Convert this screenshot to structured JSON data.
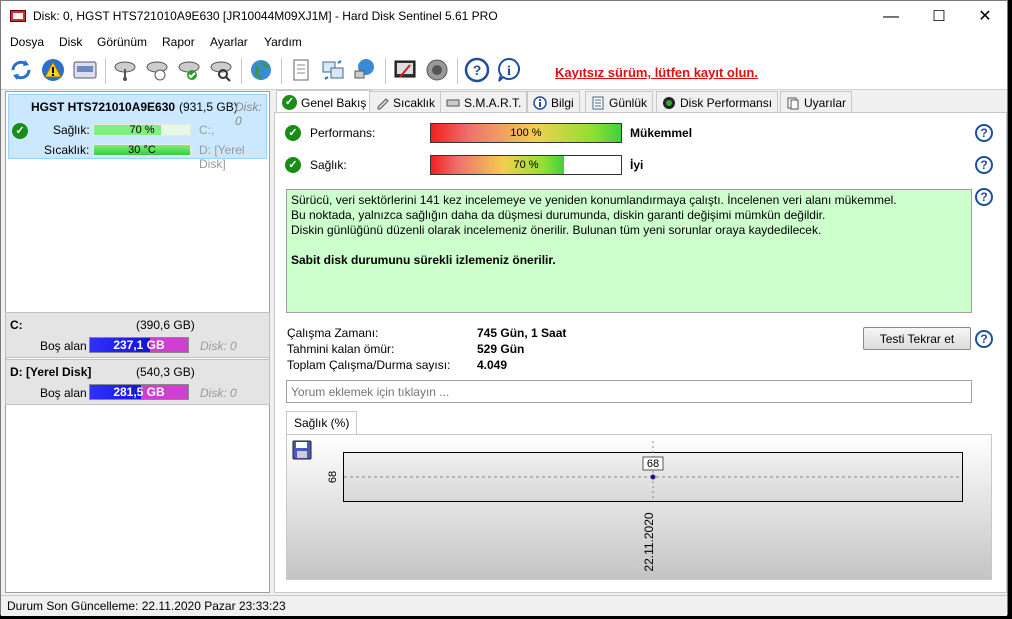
{
  "window": {
    "title": "Disk: 0, HGST HTS721010A9E630 [JR10044M09XJ1M]  -  Hard Disk Sentinel 5.61 PRO",
    "minimize": "—",
    "maximize": "☐",
    "close": "✕"
  },
  "menu": [
    "Dosya",
    "Disk",
    "Görünüm",
    "Rapor",
    "Ayarlar",
    "Yardım"
  ],
  "toolbar": {
    "buttons": [
      "refresh-icon",
      "warning-icon",
      "disk-info-icon",
      "disk-surface-icon",
      "disk-test-icon",
      "disk-check-icon",
      "disk-search-icon",
      "internet-icon",
      "report-icon",
      "sync-icon",
      "network-icon",
      "settings-icon",
      "sound-icon",
      "help-icon",
      "info-icon"
    ],
    "register_text": "Kayıtsız sürüm, lütfen kayıt olun."
  },
  "disk": {
    "name": "HGST HTS721010A9E630",
    "size": "(931,5 GB)",
    "disk_num": "Disk: 0",
    "health_label": "Sağlık:",
    "health_value": "70 %",
    "health_fraction": 0.7,
    "temp_label": "Sıcaklık:",
    "temp_value": "30 °C",
    "drive_c_ref": "C:,",
    "drive_d_ref": "D: [Yerel Disk]"
  },
  "drives": [
    {
      "letter": "C:",
      "size": "(390,6 GB)",
      "free_label": "Boş alan",
      "free": "237,1 GB",
      "free_fraction": 0.61,
      "disk": "Disk: 0"
    },
    {
      "letter": "D: [Yerel Disk]",
      "size": "(540,3 GB)",
      "free_label": "Boş alan",
      "free": "281,5 GB",
      "free_fraction": 0.52,
      "disk": "Disk: 0"
    }
  ],
  "tabs": [
    "Genel Bakış",
    "Sıcaklık",
    "S.M.A.R.T.",
    "Bilgi",
    "Günlük",
    "Disk Performansı",
    "Uyarılar"
  ],
  "overview": {
    "performance_label": "Performans:",
    "performance_value": "100 %",
    "performance_fraction": 1.0,
    "performance_rating": "Mükemmel",
    "health_label": "Sağlık:",
    "health_value": "70 %",
    "health_fraction": 0.7,
    "health_rating": "İyi",
    "message_lines": [
      "Sürücü, veri sektörlerini 141 kez incelemeye ve yeniden konumlandırmaya çalıştı. İncelenen veri alanı mükemmel.",
      "Bu noktada, yalnızca sağlığın daha da düşmesi durumunda, diskin garanti değişimi mümkün değildir.",
      "Diskin günlüğünü düzenli olarak incelemeniz önerilir. Bulunan tüm yeni sorunlar oraya kaydedilecek."
    ],
    "message_bold": "Sabit disk durumunu sürekli izlemeniz önerilir.",
    "uptime_label": "Çalışma Zamanı:",
    "uptime_value": "745 Gün, 1 Saat",
    "remaining_label": "Tahmini kalan ömür:",
    "remaining_value": "529 Gün",
    "startstop_label": "Toplam Çalışma/Durma sayısı:",
    "startstop_value": "4.049",
    "retest_button": "Testi Tekrar et",
    "comment_placeholder": "Yorum eklemek için tıklayın ..."
  },
  "chart_tab": "Sağlık (%)",
  "chart_data": {
    "type": "line",
    "x": [
      "22.11.2020"
    ],
    "series": [
      {
        "values": [
          68
        ]
      }
    ],
    "ytick": "68",
    "data_label": "68",
    "ylim": [
      68,
      68
    ],
    "grid": true
  },
  "status": "Durum Son Güncelleme: 22.11.2020 Pazar 23:33:23"
}
